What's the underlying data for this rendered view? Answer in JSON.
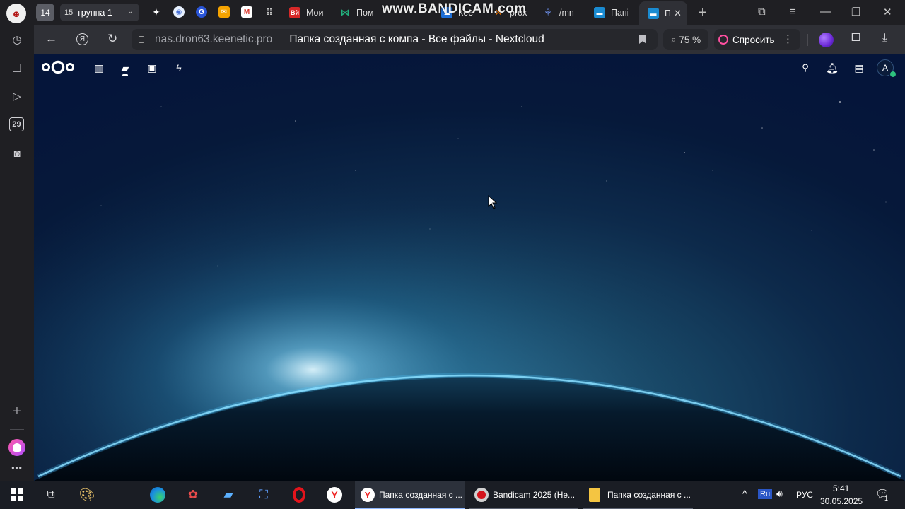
{
  "browser": {
    "tab_group_count": "14",
    "tab_group": {
      "badge": "15",
      "name": "группа 1"
    },
    "tabs": [
      {
        "label": "Мои",
        "icon": "vk-music-icon"
      },
      {
        "label": "Пом",
        "icon": "keenetic-icon"
      },
      {
        "label": "Кее",
        "icon": "keenetic-cloud-icon"
      },
      {
        "label": "prox",
        "icon": "proxmox-icon"
      },
      {
        "label": "/mn",
        "icon": "filebrowser-icon"
      },
      {
        "label": "Папі",
        "icon": "nextcloud-folder-icon"
      },
      {
        "label": "П",
        "icon": "nextcloud-folder-icon",
        "active": true
      }
    ],
    "watermark": "www.BANDICAM.com",
    "address": {
      "domain": "nas.dron63.keenetic.pro",
      "page_title": "Папка созданная с компа - Все файлы - Nextcloud"
    },
    "zoom": "75 %",
    "ask_label": "Спросить",
    "sidebar": {
      "calendar_day": "29"
    }
  },
  "nextcloud": {
    "avatar_letter": "A",
    "nav": [
      "dashboard-icon",
      "files-icon",
      "photos-icon",
      "activity-icon"
    ],
    "colors": {
      "bg_top": "#05153a",
      "glow": "#7fd8ff"
    }
  },
  "taskbar": {
    "apps": [
      {
        "label": "Папка созданная с ...",
        "icon": "yandex-browser-icon",
        "active": true
      },
      {
        "label": "Bandicam 2025 (Не...",
        "icon": "bandicam-icon"
      },
      {
        "label": "Папка созданная с ...",
        "icon": "explorer-folder-icon"
      }
    ],
    "tray": {
      "ime": "Ru",
      "lang": "РУС",
      "time": "5:41",
      "date": "30.05.2025",
      "notifications": "1"
    }
  }
}
